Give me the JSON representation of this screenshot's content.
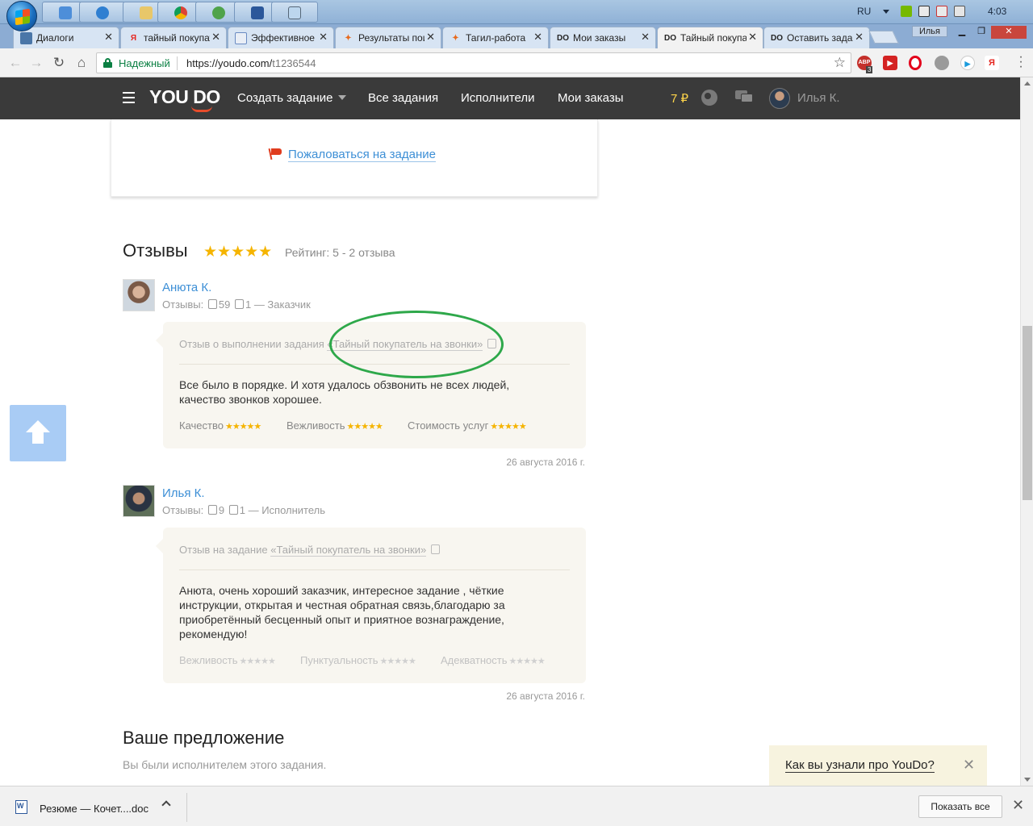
{
  "os": {
    "language": "RU",
    "clock": "4:03"
  },
  "browser": {
    "tabs": [
      {
        "title": "Диалоги",
        "favicon": "dialog-icon"
      },
      {
        "title": "тайный покупатель",
        "favicon": "yandex-icon"
      },
      {
        "title": "Эффективное",
        "favicon": "doc-icon"
      },
      {
        "title": "Результаты поиска",
        "favicon": "runner-icon"
      },
      {
        "title": "Тагил-работа",
        "favicon": "runner-icon"
      },
      {
        "title": "Мои заказы",
        "favicon": "youdo-icon"
      },
      {
        "title": "Тайный покупатель",
        "favicon": "youdo-icon"
      },
      {
        "title": "Оставить задание",
        "favicon": "youdo-icon"
      }
    ],
    "active_tab_index": 6,
    "profile_name": "Илья",
    "security_label": "Надежный",
    "url_host": "https://youdo.com/",
    "url_path": "t1236544",
    "extensions": {
      "adblock_label": "ABP",
      "adblock_count": "3",
      "yandex_label": "Я"
    }
  },
  "header": {
    "logo": "YOU DO",
    "nav": {
      "create_task": "Создать задание",
      "all_tasks": "Все задания",
      "performers": "Исполнители",
      "my_orders": "Мои заказы"
    },
    "balance": "7 ₽",
    "user_name": "Илья К."
  },
  "task": {
    "complain_link": "Пожаловаться на задание"
  },
  "reviews": {
    "title": "Отзывы",
    "stars": "★★★★★",
    "rating_text": "Рейтинг: 5 - 2 отзыва",
    "items": [
      {
        "author": "Анюта К.",
        "meta_prefix": "Отзывы:",
        "likes": "59",
        "dislikes": "1",
        "role": "— Заказчик",
        "head_prefix": "Отзыв о выполнении задания",
        "task_link": "«Тайный покупатель на звонки»",
        "text": "Все было в порядке. И хотя удалось обзвонить не всех людей, качество звонков хорошее.",
        "criteria": [
          {
            "label": "Качество",
            "stars": "★★★★★"
          },
          {
            "label": "Вежливость",
            "stars": "★★★★★"
          },
          {
            "label": "Стоимость услуг",
            "stars": "★★★★★"
          }
        ],
        "date": "26 августа 2016 г."
      },
      {
        "author": "Илья К.",
        "meta_prefix": "Отзывы:",
        "likes": "9",
        "dislikes": "1",
        "role": "— Исполнитель",
        "head_prefix": "Отзыв на задание",
        "task_link": "«Тайный покупатель на звонки»",
        "text": "Анюта, очень хороший заказчик, интересное задание , чёткие инструкции, открытая и честная обратная связь,благодарю за приобретённый бесценный опыт и приятное вознаграждение, рекомендую!",
        "criteria": [
          {
            "label": "Вежливость",
            "stars": "★★★★★"
          },
          {
            "label": "Пунктуальность",
            "stars": "★★★★★"
          },
          {
            "label": "Адекватность",
            "stars": "★★★★★"
          }
        ],
        "date": "26 августа 2016 г."
      }
    ]
  },
  "offer": {
    "title": "Ваше предложение",
    "subtitle": "Вы были исполнителем этого задания."
  },
  "popup": {
    "question": "Как вы узнали про YouDo?",
    "close": "✕"
  },
  "downloads": {
    "file_name": "Резюме — Кочет....doc",
    "show_all": "Показать все",
    "close": "✕"
  },
  "colors": {
    "accent_link": "#3d8fd6",
    "star": "#f5b400",
    "header_bg": "#3a3a3a",
    "annotation_ellipse": "#2ea84a"
  }
}
